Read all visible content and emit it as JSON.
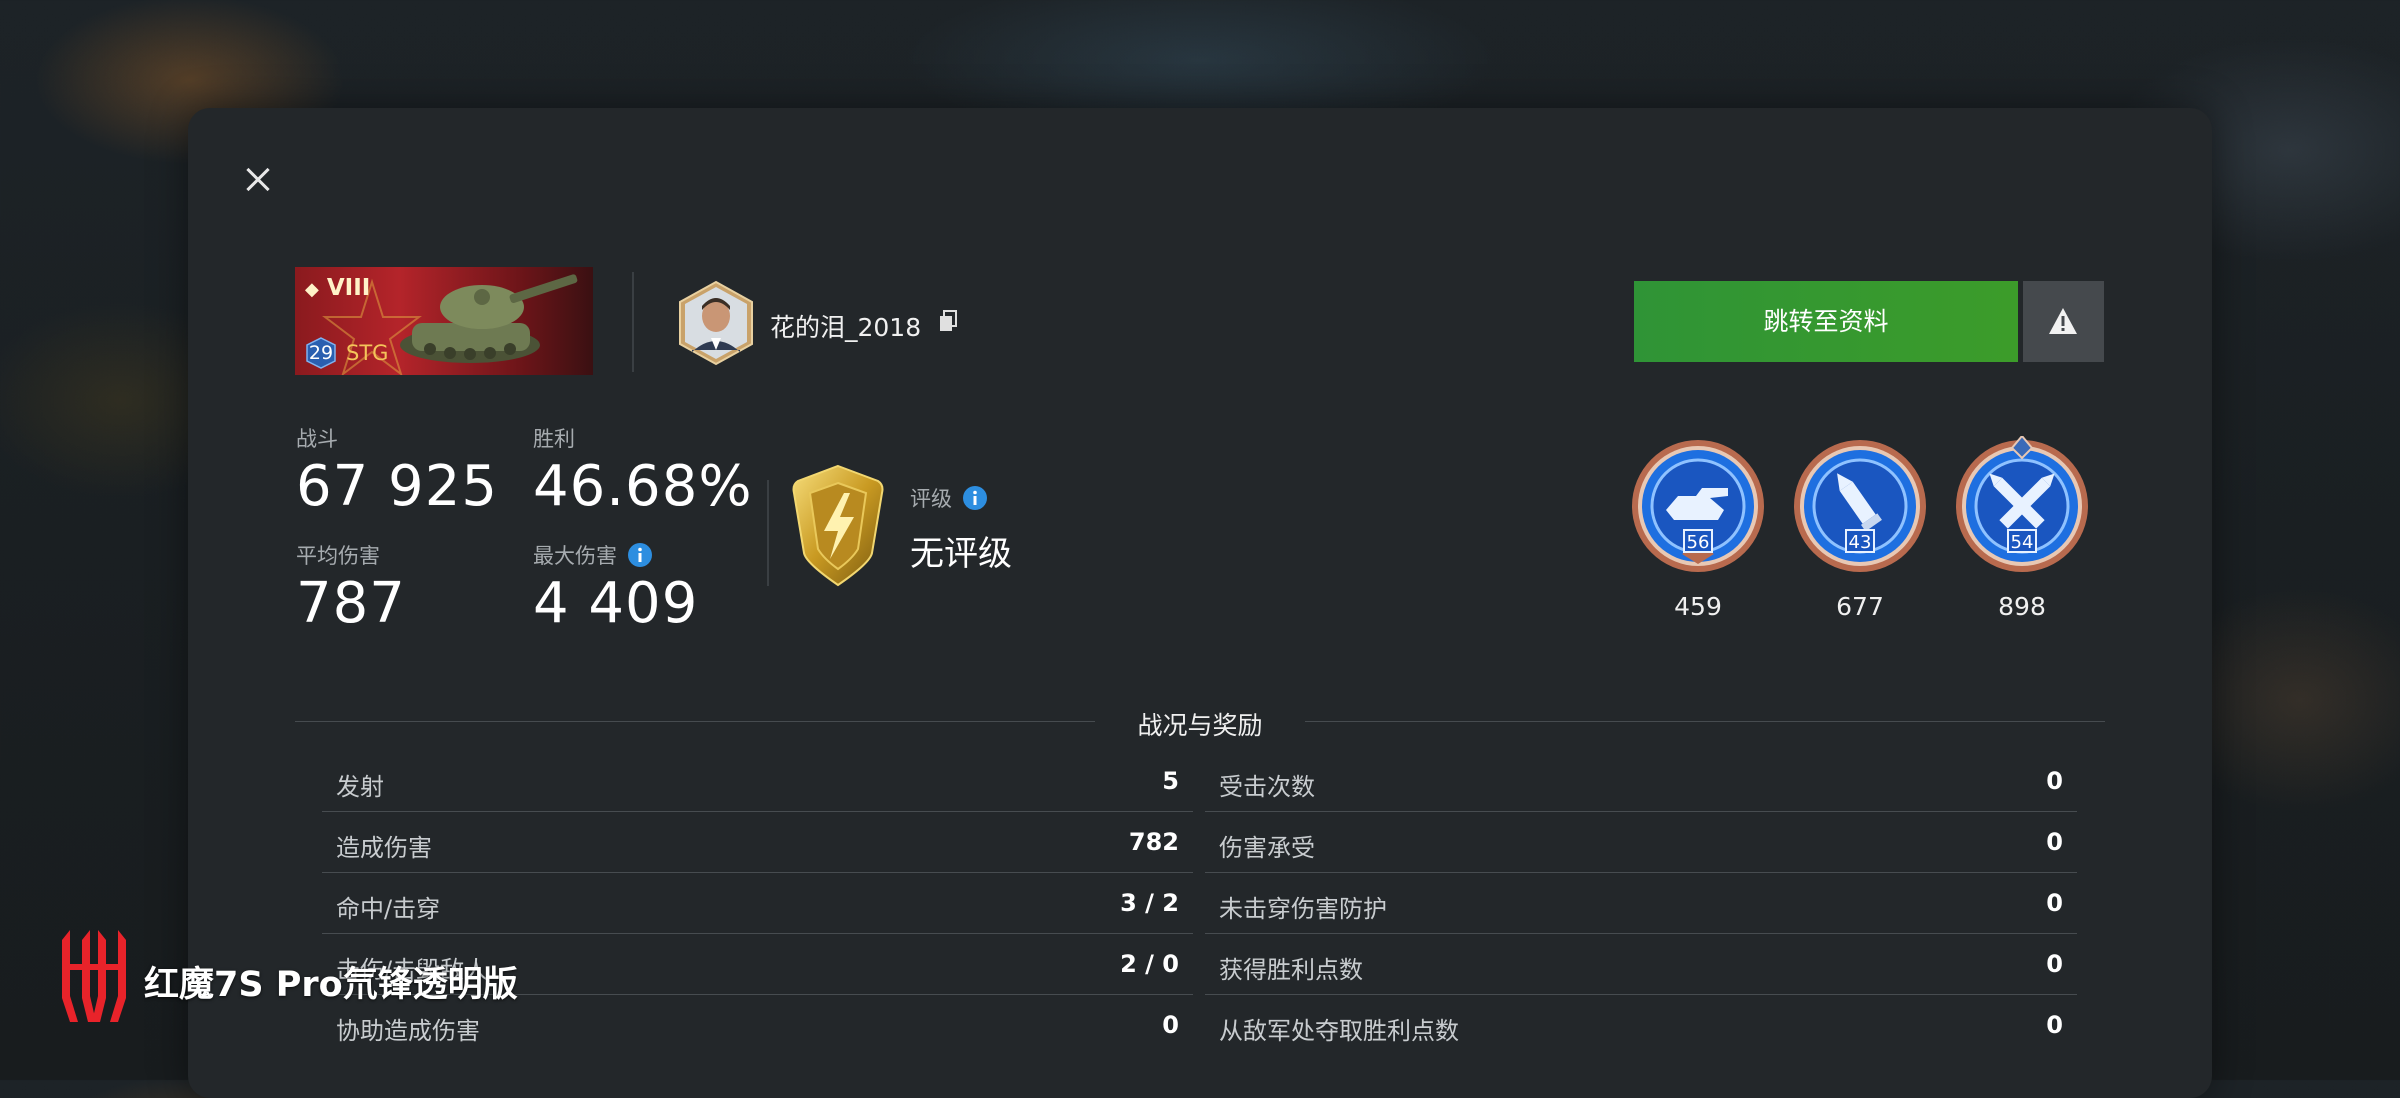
{
  "header": {
    "tank": {
      "tier": "VIII",
      "level": "29",
      "clan": "STG"
    },
    "player": {
      "name": "花的泪_2018"
    },
    "profile_button": "跳转至资料"
  },
  "stats": {
    "battles": {
      "label": "战斗",
      "value": "67 925"
    },
    "wins": {
      "label": "胜利",
      "value": "46.68%"
    },
    "avg_damage": {
      "label": "平均伤害",
      "value": "787"
    },
    "max_damage": {
      "label": "最大伤害",
      "value": "4 409"
    }
  },
  "rating": {
    "label": "评级",
    "value": "无评级"
  },
  "medals": [
    {
      "icon": "tank-medal-icon",
      "level": "56",
      "count": "459"
    },
    {
      "icon": "shell-medal-icon",
      "level": "43",
      "count": "677"
    },
    {
      "icon": "crossed-shells-medal-icon",
      "level": "54",
      "count": "898"
    }
  ],
  "section_title": "战况与奖励",
  "table_left": [
    {
      "label": "发射",
      "value": "5"
    },
    {
      "label": "造成伤害",
      "value": "782"
    },
    {
      "label": "命中/击穿",
      "value": "3 / 2"
    },
    {
      "label": "击伤/击毁敌人",
      "value": "2 / 0"
    },
    {
      "label": "协助造成伤害",
      "value": "0"
    }
  ],
  "table_right": [
    {
      "label": "受击次数",
      "value": "0"
    },
    {
      "label": "伤害承受",
      "value": "0"
    },
    {
      "label": "未击穿伤害防护",
      "value": "0"
    },
    {
      "label": "获得胜利点数",
      "value": "0"
    },
    {
      "label": "从敌军处夺取胜利点数",
      "value": "0"
    }
  ],
  "watermark": "红魔7S Pro氘锋透明版",
  "colors": {
    "accent_green": "#3c9c2a",
    "panel": "#23272a",
    "medal_blue": "#1e6fe0",
    "gold": "#d4a72c"
  }
}
